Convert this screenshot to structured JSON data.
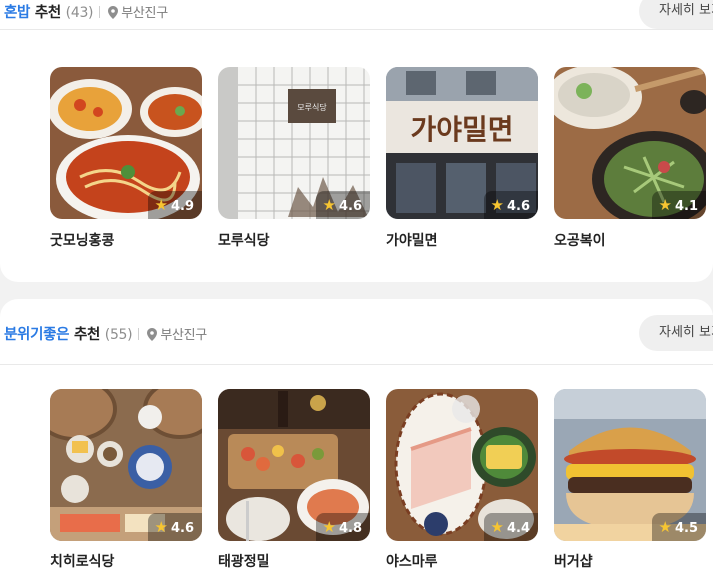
{
  "sections": [
    {
      "keyword": "혼밥",
      "suffix": " 추천",
      "count": "(43)",
      "location": "부산진구",
      "more_label": "자세히 보기",
      "places": [
        {
          "name": "굿모닝홍콩",
          "rating": "4.9"
        },
        {
          "name": "모루식당",
          "rating": "4.6"
        },
        {
          "name": "가야밀면",
          "rating": "4.6"
        },
        {
          "name": "오공복이",
          "rating": "4.1"
        }
      ]
    },
    {
      "keyword": "분위기좋은",
      "suffix": " 추천",
      "count": "(55)",
      "location": "부산진구",
      "more_label": "자세히 보기",
      "places": [
        {
          "name": "치히로식당",
          "rating": "4.6"
        },
        {
          "name": "태광정밀",
          "rating": "4.8"
        },
        {
          "name": "야스마루",
          "rating": "4.4"
        },
        {
          "name": "버거샵",
          "rating": "4.5"
        }
      ]
    }
  ],
  "photo_signs": {
    "moru": "모루식당",
    "gaya": "가야밀면"
  },
  "icons": {
    "pin": "location-pin-icon",
    "star": "star-icon"
  },
  "colors": {
    "accent": "#2b7be4",
    "star": "#f7c531"
  }
}
